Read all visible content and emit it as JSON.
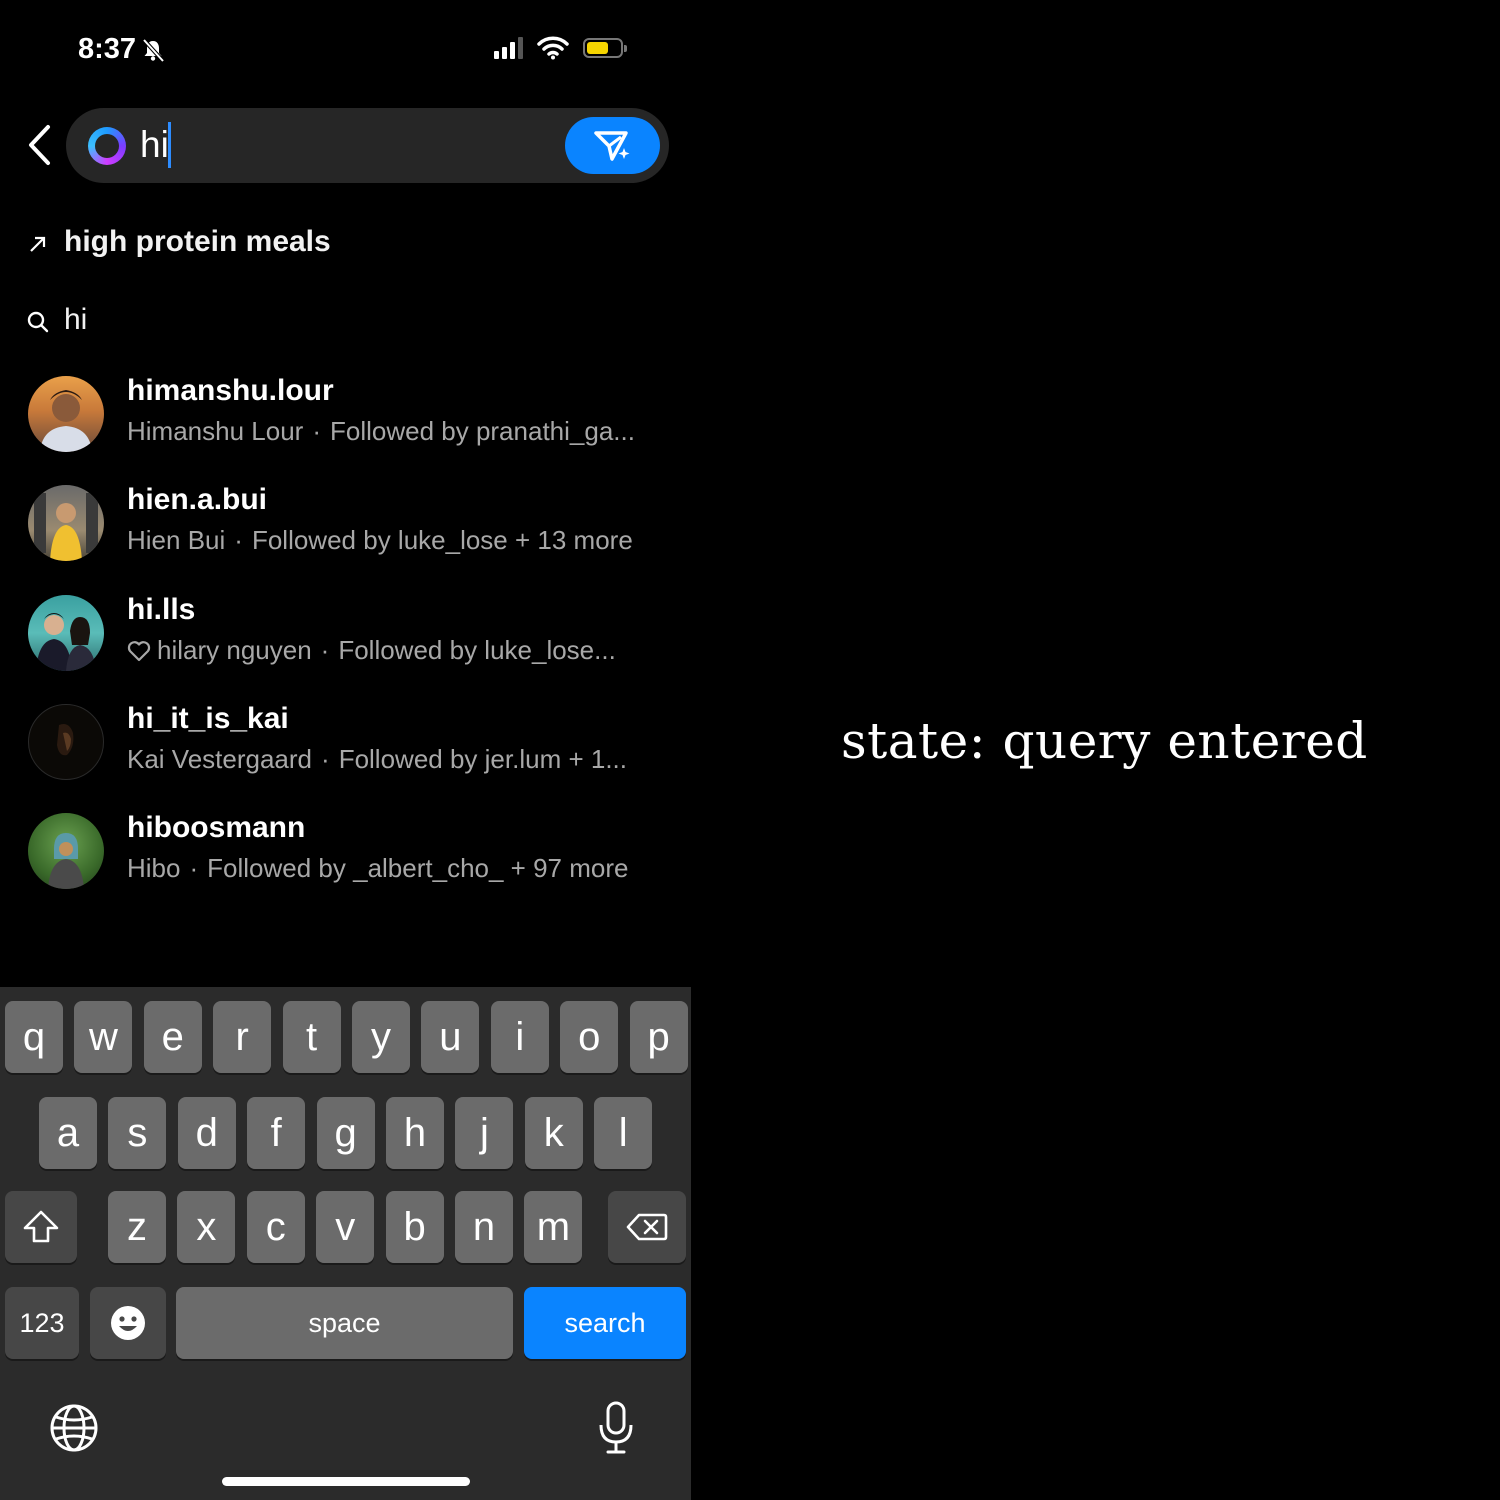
{
  "status_bar": {
    "time": "8:37"
  },
  "search": {
    "query": "hi"
  },
  "suggestions": [
    {
      "icon": "trending-arrow-icon",
      "label": "high protein meals"
    },
    {
      "icon": "search-icon",
      "label": "hi"
    }
  ],
  "results": [
    {
      "handle": "himanshu.lour",
      "name": "Himanshu Lour",
      "dot": "·",
      "followed": "Followed by pranathi_ga...",
      "heart": false
    },
    {
      "handle": "hien.a.bui",
      "name": "Hien Bui",
      "dot": "·",
      "followed": "Followed by luke_lose + 13 more",
      "heart": false
    },
    {
      "handle": "hi.lls",
      "name": "hilary nguyen",
      "dot": "·",
      "followed": "Followed by luke_lose...",
      "heart": true
    },
    {
      "handle": "hi_it_is_kai",
      "name": "Kai Vestergaard",
      "dot": "·",
      "followed": "Followed by jer.lum + 1...",
      "heart": false
    },
    {
      "handle": "hiboosmann",
      "name": "Hibo",
      "dot": "·",
      "followed": "Followed by _albert_cho_ + 97 more",
      "heart": false
    }
  ],
  "keyboard": {
    "row1": [
      "q",
      "w",
      "e",
      "r",
      "t",
      "y",
      "u",
      "i",
      "o",
      "p"
    ],
    "row2": [
      "a",
      "s",
      "d",
      "f",
      "g",
      "h",
      "j",
      "k",
      "l"
    ],
    "row3": [
      "z",
      "x",
      "c",
      "v",
      "b",
      "n",
      "m"
    ],
    "numbers_label": "123",
    "space_label": "space",
    "search_label": "search"
  },
  "caption": "state: query entered",
  "colors": {
    "accent": "#0a84ff",
    "background": "#000000",
    "secondary_text": "#a8a8a8"
  }
}
